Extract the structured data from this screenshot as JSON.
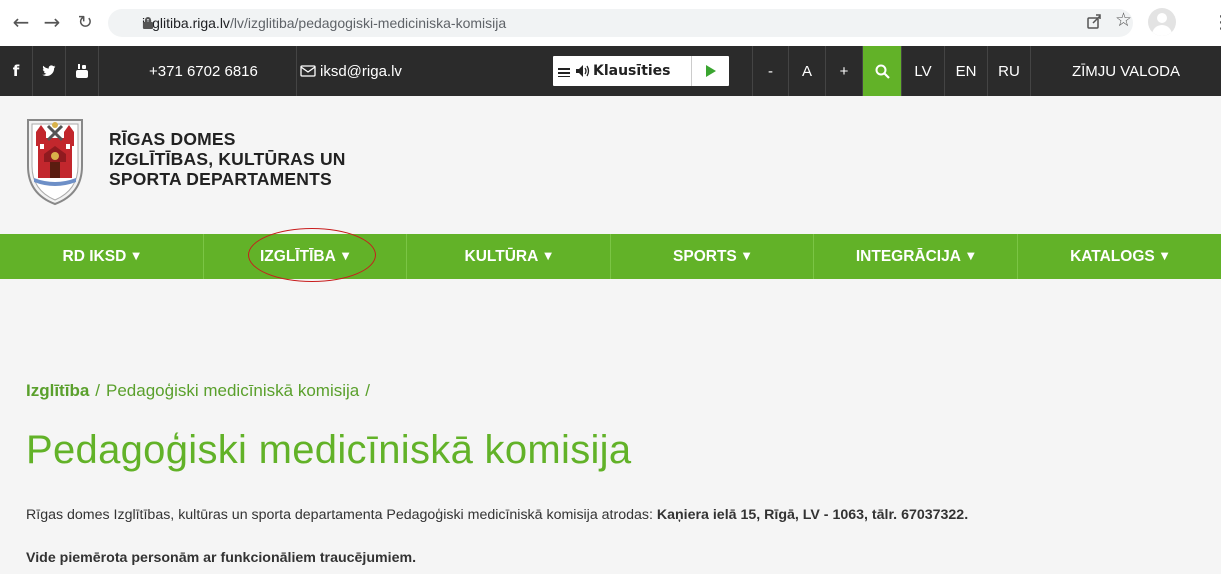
{
  "browser": {
    "url_host": "izglitiba.riga.lv",
    "url_path": "/lv/izglitiba/pedagogiski-mediciniska-komisija",
    "icons": [
      "back-icon",
      "forward-icon",
      "reload-icon",
      "lock-icon",
      "share-icon",
      "star-icon",
      "profile-icon",
      "menu-icon"
    ]
  },
  "topbar": {
    "facebook": "f",
    "twitter": "🐦",
    "youtube": "You Tube",
    "phone": "+371 6702 6816",
    "email": "iksd@riga.lv",
    "listen_label": "Klausīties",
    "font_minus": "-",
    "font_a": "A",
    "font_plus": "+",
    "lang_lv": "LV",
    "lang_en": "EN",
    "lang_ru": "RU",
    "sign_language": "ZĪMJU VALODA"
  },
  "header": {
    "org_line1": "RĪGAS DOMES",
    "org_line2": "IZGLĪTĪBAS, KULTŪRAS UN",
    "org_line3": "SPORTA DEPARTAMENTS"
  },
  "mainnav": {
    "items": [
      {
        "label": "RD IKSD"
      },
      {
        "label": "IZGLĪTĪBA"
      },
      {
        "label": "KULTŪRA"
      },
      {
        "label": "SPORTS"
      },
      {
        "label": "INTEGRĀCIJA"
      },
      {
        "label": "KATALOGS"
      }
    ]
  },
  "breadcrumb": {
    "item1": "Izglītība",
    "sep": "/",
    "item2": "Pedagoģiski medicīniskā komisija",
    "sep2": "/"
  },
  "content": {
    "title": "Pedagoģiski medicīniskā komisija",
    "para1_text": "Rīgas domes Izglītības, kultūras un sporta departamenta Pedagoģiski medicīniskā komisija atrodas: ",
    "para1_address": "Kaņiera ielā 15, Rīgā, LV - 1063, tālr. 67037322.",
    "para2": "Vide piemērota personām ar funkcionāliem traucējumiem."
  },
  "colors": {
    "accent_green": "#62b228",
    "topbar_bg": "#2b2b2b",
    "highlight_red": "#c81d1d"
  }
}
